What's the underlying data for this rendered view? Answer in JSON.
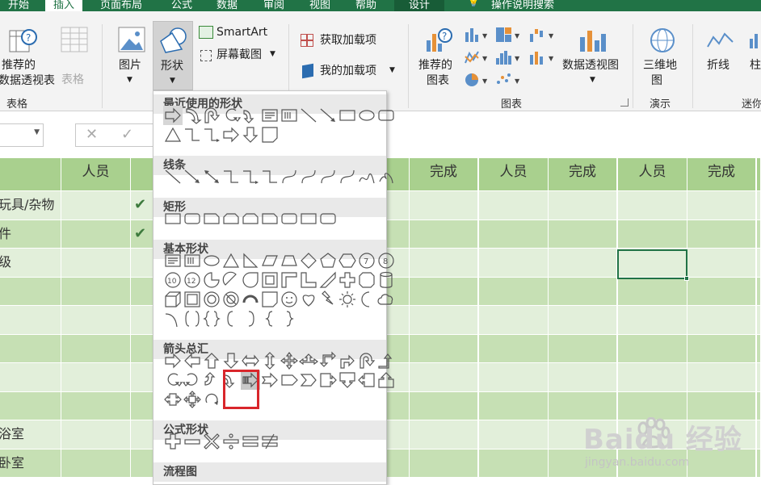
{
  "tabs": [
    "开始",
    "插入",
    "页面布局",
    "公式",
    "数据",
    "审阅",
    "视图",
    "帮助",
    "设计",
    "操作说明搜索"
  ],
  "ribbon": {
    "recommended_pivot": [
      "推荐的",
      "数据透视表"
    ],
    "table": "表格",
    "picture": "图片",
    "shapes": "形状",
    "smartart": "SmartArt",
    "screenshot": "屏幕截图",
    "get_addins": "获取加载项",
    "my_addins": "我的加载项",
    "recommended_charts": [
      "推荐的",
      "图表"
    ],
    "pivot_chart": "数据透视图",
    "map3d": [
      "三维地",
      "图"
    ],
    "line": "折线",
    "column": "柱",
    "group_tables": "表格",
    "group_charts": "图表",
    "group_tours": "演示",
    "group_sparklines": "迷你"
  },
  "sheet": {
    "headers": [
      "人员",
      "完成",
      "人员",
      "完成",
      "人员",
      "完成",
      "人员",
      "完成"
    ],
    "rows": [
      "玩具/杂物",
      "件",
      "级",
      "",
      "",
      "",
      "",
      "",
      "浴室",
      "卧室"
    ],
    "check": "✔"
  },
  "shapes_menu": {
    "sections": [
      "最近使用的形状",
      "线条",
      "矩形",
      "基本形状",
      "箭头总汇",
      "公式形状",
      "流程图"
    ]
  },
  "watermark": {
    "brand": "Baidu 经验",
    "url": "jingyan.baidu.com"
  },
  "colors": {
    "accent": "#217346",
    "header_green": "#a9d08e",
    "row_light": "#e2efda",
    "row_mid": "#c6e0b4",
    "highlight_red": "#d9262b"
  }
}
